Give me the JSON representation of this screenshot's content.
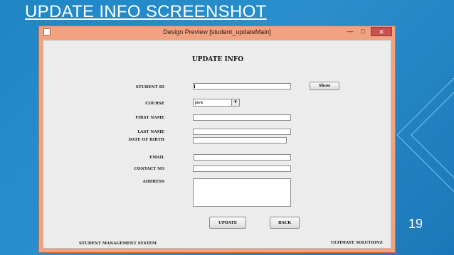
{
  "slide": {
    "title": "UPDATE INFO SCREENSHOT",
    "number": "19"
  },
  "window": {
    "title": "Design Preview [student_updateMain]",
    "controls": {
      "minimize": "—",
      "maximize": "□",
      "close": "✕"
    }
  },
  "form": {
    "heading": "UPDATE INFO",
    "labels": {
      "student_id": "STUDENT ID",
      "course": "COURSE",
      "first_name": "FIRST NAME",
      "last_name": "LAST NAME",
      "dob": "DATE OF BIRTH",
      "email": "EMAIL",
      "contact": "CONTACT NO",
      "address": "ADDRESS"
    },
    "values": {
      "student_id": "",
      "course": "java",
      "first_name": "",
      "last_name": "",
      "dob": "",
      "email": "",
      "contact": "",
      "address": ""
    },
    "buttons": {
      "show": "Show",
      "update": "UPDATE",
      "back": "BACK"
    }
  },
  "footer": {
    "left": "STUDENT MANAGEMENT SYSTEM",
    "right": "ULTIMATE SOLUTIONZ"
  },
  "icons": {
    "combo_arrow": "▼"
  },
  "colors": {
    "slide_background": "#1f86c6",
    "window_frame": "#f2a27f",
    "close_button": "#c75050"
  }
}
